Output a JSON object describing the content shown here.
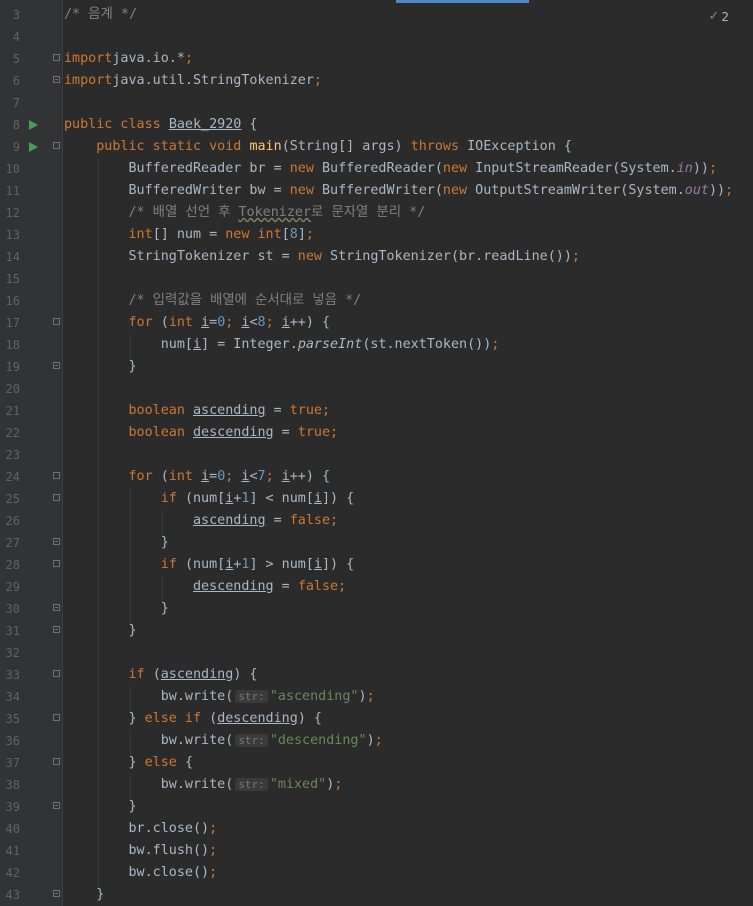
{
  "editor": {
    "inspection": {
      "icon": "check-double-icon",
      "count": "2"
    },
    "run_icon": "run-gutter-icon"
  },
  "lines": [
    {
      "n": "3",
      "t": [
        [
          "cm",
          "/* 음계 */"
        ]
      ]
    },
    {
      "n": "4",
      "t": []
    },
    {
      "n": "5",
      "fold": "open",
      "t": [
        [
          "kw",
          "import"
        ],
        [
          "",
          "java.io.*"
        ],
        [
          "kw",
          ";"
        ]
      ]
    },
    {
      "n": "6",
      "fold": "close",
      "t": [
        [
          "kw",
          "import"
        ],
        [
          "",
          "java.util.StringTokenizer"
        ],
        [
          "kw",
          ";"
        ]
      ]
    },
    {
      "n": "7",
      "t": []
    },
    {
      "n": "8",
      "run": true,
      "t": [
        [
          "kw",
          "public class "
        ],
        [
          "ul",
          "Baek_2920"
        ],
        [
          "",
          " {"
        ]
      ]
    },
    {
      "n": "9",
      "run": true,
      "fold": "open",
      "t": [
        [
          "",
          "    "
        ],
        [
          "kw",
          "public static void "
        ],
        [
          "fn",
          "main"
        ],
        [
          "",
          "(String[] args) "
        ],
        [
          "kw",
          "throws "
        ],
        [
          "",
          "IOException {"
        ]
      ]
    },
    {
      "n": "10",
      "t": [
        [
          "",
          "        BufferedReader br = "
        ],
        [
          "kw",
          "new "
        ],
        [
          "",
          "BufferedReader("
        ],
        [
          "kw",
          "new "
        ],
        [
          "",
          "InputStreamReader(System."
        ],
        [
          "sf",
          "in"
        ],
        [
          "",
          "))"
        ],
        [
          "kw",
          ";"
        ]
      ]
    },
    {
      "n": "11",
      "t": [
        [
          "",
          "        BufferedWriter bw = "
        ],
        [
          "kw",
          "new "
        ],
        [
          "",
          "BufferedWriter("
        ],
        [
          "kw",
          "new "
        ],
        [
          "",
          "OutputStreamWriter(System."
        ],
        [
          "sf",
          "out"
        ],
        [
          "",
          "))"
        ],
        [
          "kw",
          ";"
        ]
      ]
    },
    {
      "n": "12",
      "t": [
        [
          "",
          "        "
        ],
        [
          "cm",
          "/* 배열 선언 후 "
        ],
        [
          "cmtypo",
          "Tokenizer"
        ],
        [
          "cm",
          "로 문자열 분리 */"
        ]
      ]
    },
    {
      "n": "13",
      "t": [
        [
          "",
          "        "
        ],
        [
          "kw",
          "int"
        ],
        [
          "",
          "[] num = "
        ],
        [
          "kw",
          "new int"
        ],
        [
          "",
          "["
        ],
        [
          "nm",
          "8"
        ],
        [
          "",
          "]"
        ],
        [
          "kw",
          ";"
        ]
      ]
    },
    {
      "n": "14",
      "t": [
        [
          "",
          "        StringTokenizer st = "
        ],
        [
          "kw",
          "new "
        ],
        [
          "",
          "StringTokenizer(br.readLine())"
        ],
        [
          "kw",
          ";"
        ]
      ]
    },
    {
      "n": "15",
      "t": []
    },
    {
      "n": "16",
      "t": [
        [
          "",
          "        "
        ],
        [
          "cm",
          "/* 입력값을 배열에 순서대로 넣음 */"
        ]
      ]
    },
    {
      "n": "17",
      "fold": "open",
      "t": [
        [
          "",
          "        "
        ],
        [
          "kw",
          "for "
        ],
        [
          "",
          "("
        ],
        [
          "kw",
          "int "
        ],
        [
          "ul",
          "i"
        ],
        [
          "",
          "="
        ],
        [
          "nm",
          "0"
        ],
        [
          "kw",
          "; "
        ],
        [
          "ul",
          "i"
        ],
        [
          "",
          "<"
        ],
        [
          "nm",
          "8"
        ],
        [
          "kw",
          "; "
        ],
        [
          "ul",
          "i"
        ],
        [
          "",
          "++) {"
        ]
      ]
    },
    {
      "n": "18",
      "t": [
        [
          "",
          "            num["
        ],
        [
          "ul",
          "i"
        ],
        [
          "",
          "] = Integer."
        ],
        [
          "it",
          "parseInt"
        ],
        [
          "",
          "(st.nextToken())"
        ],
        [
          "kw",
          ";"
        ]
      ]
    },
    {
      "n": "19",
      "fold": "close",
      "t": [
        [
          "",
          "        }"
        ]
      ]
    },
    {
      "n": "20",
      "t": []
    },
    {
      "n": "21",
      "t": [
        [
          "",
          "        "
        ],
        [
          "kw",
          "boolean "
        ],
        [
          "ul",
          "ascending"
        ],
        [
          "",
          " = "
        ],
        [
          "kw",
          "true;"
        ]
      ]
    },
    {
      "n": "22",
      "t": [
        [
          "",
          "        "
        ],
        [
          "kw",
          "boolean "
        ],
        [
          "ul",
          "descending"
        ],
        [
          "",
          " = "
        ],
        [
          "kw",
          "true;"
        ]
      ]
    },
    {
      "n": "23",
      "t": []
    },
    {
      "n": "24",
      "fold": "open",
      "t": [
        [
          "",
          "        "
        ],
        [
          "kw",
          "for "
        ],
        [
          "",
          "("
        ],
        [
          "kw",
          "int "
        ],
        [
          "ul",
          "i"
        ],
        [
          "",
          "="
        ],
        [
          "nm",
          "0"
        ],
        [
          "kw",
          "; "
        ],
        [
          "ul",
          "i"
        ],
        [
          "",
          "<"
        ],
        [
          "nm",
          "7"
        ],
        [
          "kw",
          "; "
        ],
        [
          "ul",
          "i"
        ],
        [
          "",
          "++) {"
        ]
      ]
    },
    {
      "n": "25",
      "fold": "open",
      "t": [
        [
          "",
          "            "
        ],
        [
          "kw",
          "if "
        ],
        [
          "",
          "(num["
        ],
        [
          "ul",
          "i"
        ],
        [
          "",
          "+"
        ],
        [
          "nm",
          "1"
        ],
        [
          "",
          "] < num["
        ],
        [
          "ul",
          "i"
        ],
        [
          "",
          "]) {"
        ]
      ]
    },
    {
      "n": "26",
      "t": [
        [
          "",
          "                "
        ],
        [
          "ul",
          "ascending"
        ],
        [
          "",
          " = "
        ],
        [
          "kw",
          "false;"
        ]
      ]
    },
    {
      "n": "27",
      "fold": "close",
      "t": [
        [
          "",
          "            }"
        ]
      ]
    },
    {
      "n": "28",
      "fold": "open",
      "t": [
        [
          "",
          "            "
        ],
        [
          "kw",
          "if "
        ],
        [
          "",
          "(num["
        ],
        [
          "ul",
          "i"
        ],
        [
          "",
          "+"
        ],
        [
          "nm",
          "1"
        ],
        [
          "",
          "] > num["
        ],
        [
          "ul",
          "i"
        ],
        [
          "",
          "]) {"
        ]
      ]
    },
    {
      "n": "29",
      "t": [
        [
          "",
          "                "
        ],
        [
          "ul",
          "descending"
        ],
        [
          "",
          " = "
        ],
        [
          "kw",
          "false;"
        ]
      ]
    },
    {
      "n": "30",
      "fold": "close",
      "t": [
        [
          "",
          "            }"
        ]
      ]
    },
    {
      "n": "31",
      "fold": "close",
      "t": [
        [
          "",
          "        }"
        ]
      ]
    },
    {
      "n": "32",
      "t": []
    },
    {
      "n": "33",
      "fold": "open",
      "t": [
        [
          "",
          "        "
        ],
        [
          "kw",
          "if "
        ],
        [
          "",
          "("
        ],
        [
          "ul",
          "ascending"
        ],
        [
          "",
          ") {"
        ]
      ]
    },
    {
      "n": "34",
      "t": [
        [
          "",
          "            bw.write("
        ],
        [
          "hint",
          "str:"
        ],
        [
          "st",
          "\"ascending\""
        ],
        [
          "",
          ")"
        ],
        [
          "kw",
          ";"
        ]
      ]
    },
    {
      "n": "35",
      "fold": "open",
      "t": [
        [
          "",
          "        } "
        ],
        [
          "kw",
          "else if "
        ],
        [
          "",
          "("
        ],
        [
          "ul",
          "descending"
        ],
        [
          "",
          ") {"
        ]
      ]
    },
    {
      "n": "36",
      "t": [
        [
          "",
          "            bw.write("
        ],
        [
          "hint",
          "str:"
        ],
        [
          "st",
          "\"descending\""
        ],
        [
          "",
          ")"
        ],
        [
          "kw",
          ";"
        ]
      ]
    },
    {
      "n": "37",
      "fold": "open",
      "t": [
        [
          "",
          "        } "
        ],
        [
          "kw",
          "else "
        ],
        [
          "",
          "{"
        ]
      ]
    },
    {
      "n": "38",
      "t": [
        [
          "",
          "            bw.write("
        ],
        [
          "hint",
          "str:"
        ],
        [
          "st",
          "\"mixed\""
        ],
        [
          "",
          ")"
        ],
        [
          "kw",
          ";"
        ]
      ]
    },
    {
      "n": "39",
      "fold": "close",
      "t": [
        [
          "",
          "        }"
        ]
      ]
    },
    {
      "n": "40",
      "t": [
        [
          "",
          "        br.close()"
        ],
        [
          "kw",
          ";"
        ]
      ]
    },
    {
      "n": "41",
      "t": [
        [
          "",
          "        bw.flush()"
        ],
        [
          "kw",
          ";"
        ]
      ]
    },
    {
      "n": "42",
      "t": [
        [
          "",
          "        bw.close()"
        ],
        [
          "kw",
          ";"
        ]
      ]
    },
    {
      "n": "43",
      "fold": "close",
      "t": [
        [
          "",
          "    }"
        ]
      ]
    }
  ]
}
